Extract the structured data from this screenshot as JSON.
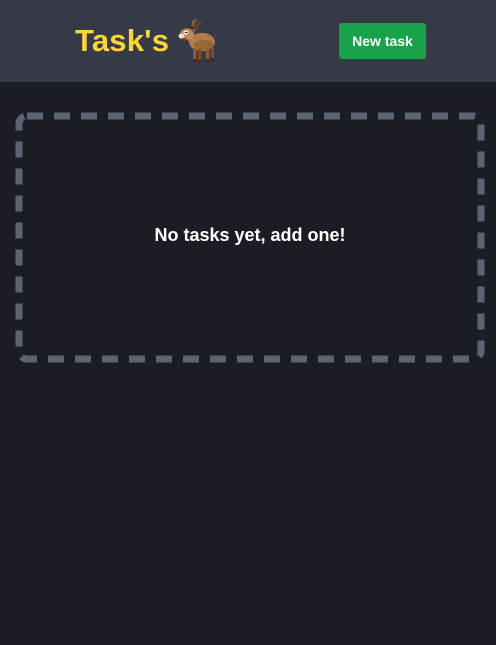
{
  "header": {
    "title": "Task's",
    "logo_icon": "goat-icon",
    "new_task_label": "New task"
  },
  "tasks": {
    "empty_message": "No tasks yet, add one!",
    "items": []
  },
  "colors": {
    "background": "#1b1d24",
    "header_background": "#363a46",
    "title": "#ffd43b",
    "button": "#18a34a",
    "dashed_border": "#5c6372"
  }
}
